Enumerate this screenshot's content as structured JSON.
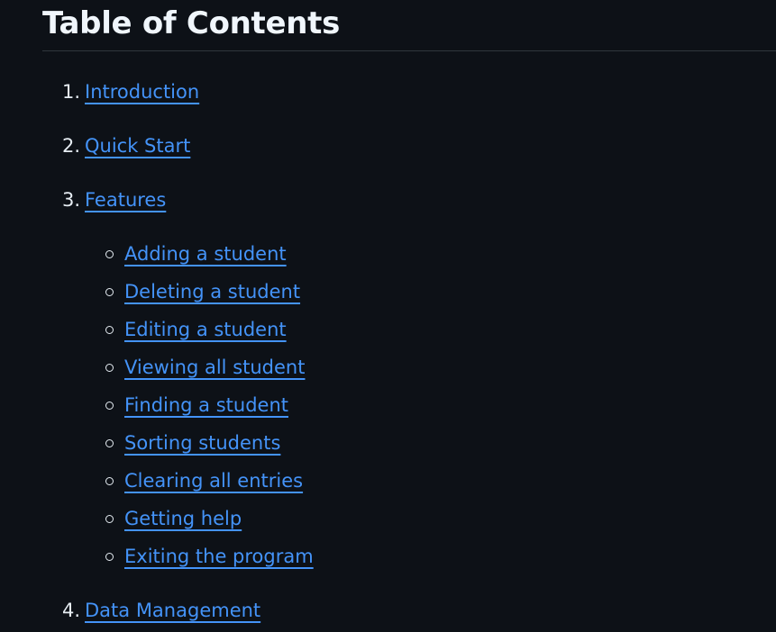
{
  "heading": "Table of Contents",
  "items": [
    {
      "num": "1.",
      "label": "Introduction"
    },
    {
      "num": "2.",
      "label": "Quick Start"
    },
    {
      "num": "3.",
      "label": "Features"
    },
    {
      "num": "4.",
      "label": "Data Management"
    }
  ],
  "features": [
    "Adding a student",
    "Deleting a student",
    "Editing a student",
    "Viewing all student",
    "Finding a student",
    "Sorting students",
    "Clearing all entries",
    "Getting help",
    "Exiting the program"
  ]
}
